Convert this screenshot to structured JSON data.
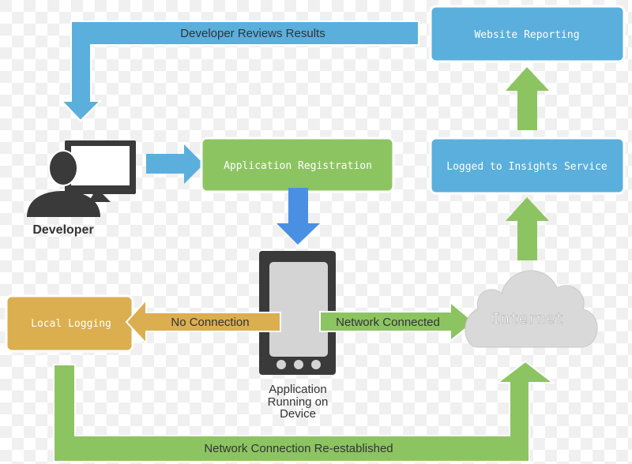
{
  "colors": {
    "blue": "#5aafdc",
    "arrow_blue": "#4a90e2",
    "green": "#8dc462",
    "gold": "#dbae4f",
    "dark": "#3a3a3a",
    "cloud": "#d9d9d9"
  },
  "nodes": {
    "website_reporting": "Website Reporting",
    "logged_insights": "Logged to Insights Service",
    "app_registration": "Application Registration",
    "local_logging": "Local Logging",
    "internet": "Internet",
    "developer": "Developer",
    "device": [
      "Application",
      "Running on",
      "Device"
    ]
  },
  "edges": {
    "reviews": "Developer Reviews Results",
    "no_connection": "No Connection",
    "network_connected": "Network Connected",
    "reestablished": "Network Connection Re-established"
  },
  "icons": {
    "developer": "person-at-monitor-icon",
    "device": "smartphone-icon",
    "internet": "cloud-icon"
  }
}
